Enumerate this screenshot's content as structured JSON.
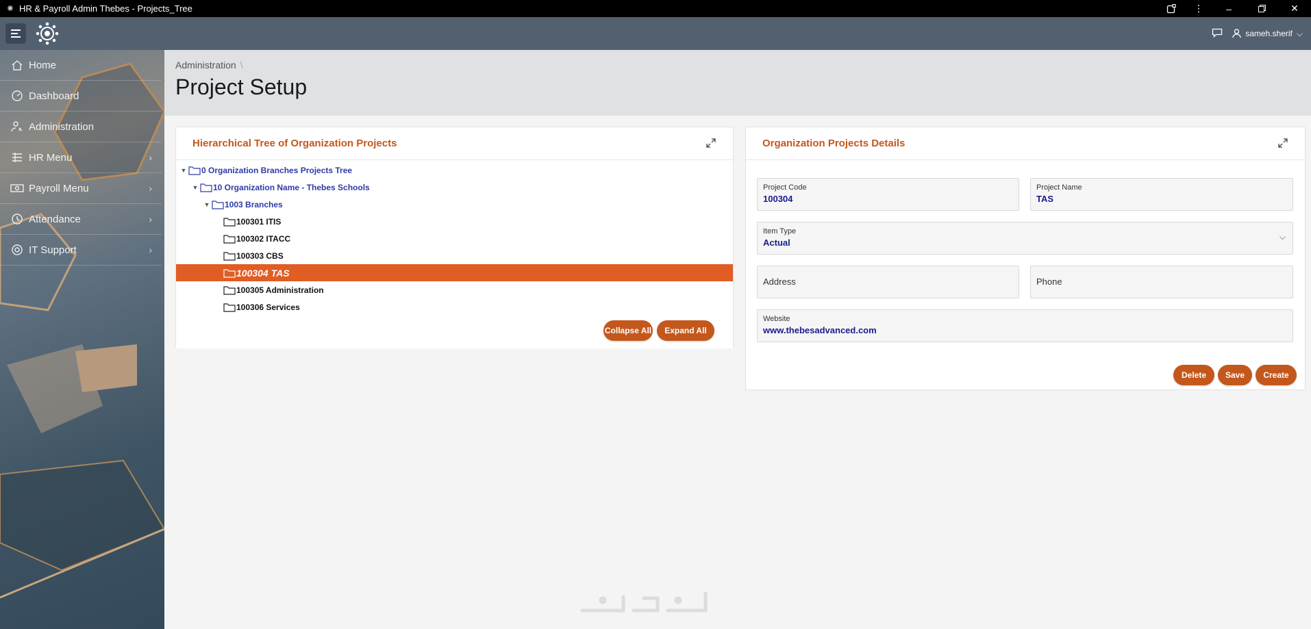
{
  "window": {
    "title": "HR & Payroll Admin Thebes - Projects_Tree",
    "controls": [
      "extension-icon",
      "more-icon",
      "minimize-icon",
      "restore-icon",
      "close-icon"
    ]
  },
  "header": {
    "user": "sameh.sherif"
  },
  "sidebar": {
    "items": [
      {
        "label": "Home",
        "icon": "home-icon",
        "has_sub": false
      },
      {
        "label": "Dashboard",
        "icon": "dashboard-icon",
        "has_sub": false
      },
      {
        "label": "Administration",
        "icon": "user-settings-icon",
        "has_sub": false
      },
      {
        "label": "HR Menu",
        "icon": "list-icon",
        "has_sub": true
      },
      {
        "label": "Payroll Menu",
        "icon": "money-icon",
        "has_sub": true
      },
      {
        "label": "Attendance",
        "icon": "clock-icon",
        "has_sub": true
      },
      {
        "label": "IT Support",
        "icon": "support-icon",
        "has_sub": true
      }
    ]
  },
  "page": {
    "breadcrumb": "Administration",
    "title": "Project Setup"
  },
  "tree_panel": {
    "title": "Hierarchical Tree of Organization Projects",
    "nodes": [
      {
        "label": "0 Organization Branches Projects Tree",
        "level": 0,
        "expanded": true,
        "style": "blue"
      },
      {
        "label": "10 Organization Name - Thebes Schools",
        "level": 1,
        "expanded": true,
        "style": "blue"
      },
      {
        "label": "1003 Branches",
        "level": 2,
        "expanded": true,
        "style": "blue"
      },
      {
        "label": "100301 ITIS",
        "level": 3,
        "style": "black"
      },
      {
        "label": "100302 ITACC",
        "level": 3,
        "style": "black"
      },
      {
        "label": "100303 CBS",
        "level": 3,
        "style": "black"
      },
      {
        "label": "100304 TAS",
        "level": 3,
        "style": "selected"
      },
      {
        "label": "100305 Administration",
        "level": 3,
        "style": "black"
      },
      {
        "label": "100306 Services",
        "level": 3,
        "style": "black"
      }
    ],
    "collapse_label": "Collapse All",
    "expand_label": "Expand All"
  },
  "details_panel": {
    "title": "Organization Projects Details",
    "project_code_label": "Project Code",
    "project_code": "100304",
    "project_name_label": "Project Name",
    "project_name": "TAS",
    "item_type_label": "Item Type",
    "item_type": "Actual",
    "address_label": "Address",
    "phone_label": "Phone",
    "website_label": "Website",
    "website": "www.thebesadvanced.com",
    "delete_label": "Delete",
    "save_label": "Save",
    "create_label": "Create"
  },
  "colors": {
    "accent": "#c4571b",
    "selected_row": "#e05d24",
    "header_bar": "#526070"
  }
}
